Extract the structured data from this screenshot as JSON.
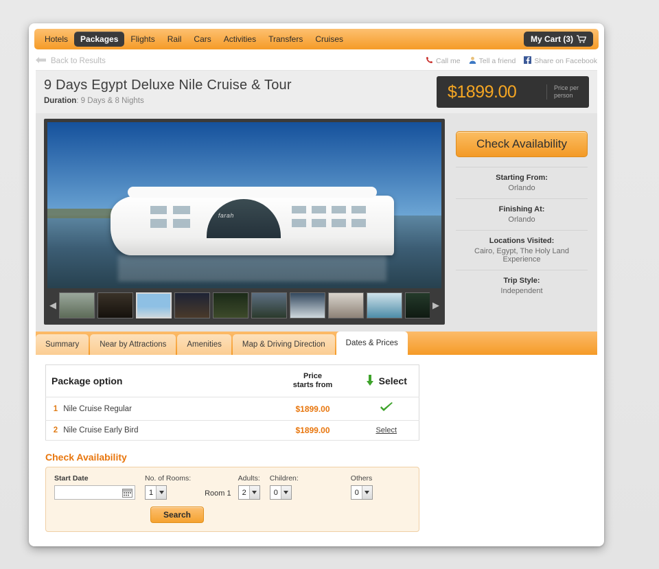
{
  "nav": {
    "items": [
      {
        "label": "Hotels",
        "active": false
      },
      {
        "label": "Packages",
        "active": true
      },
      {
        "label": "Flights",
        "active": false
      },
      {
        "label": "Rail",
        "active": false
      },
      {
        "label": "Cars",
        "active": false
      },
      {
        "label": "Activities",
        "active": false
      },
      {
        "label": "Transfers",
        "active": false
      },
      {
        "label": "Cruises",
        "active": false
      }
    ],
    "cart_label": "My Cart (3)",
    "cart_icon": "shopping-cart-icon"
  },
  "backbar": {
    "back_label": "Back to Results",
    "back_icon": "arrow-left-icon",
    "utils": [
      {
        "label": "Call me",
        "icon": "phone-icon"
      },
      {
        "label": "Tell a friend",
        "icon": "person-icon"
      },
      {
        "label": "Share on Facebook",
        "icon": "facebook-icon"
      }
    ]
  },
  "header": {
    "title": "9 Days Egypt Deluxe Nile Cruise & Tour",
    "duration_label": "Duration",
    "duration_value": "9 Days & 8 Nights",
    "price": "$1899.00",
    "price_note_line1": "Price per",
    "price_note_line2": "person",
    "price_color": "#f5a623"
  },
  "gallery": {
    "prev_icon": "chevron-left-icon",
    "next_icon": "chevron-right-icon",
    "main_image_alt": "Nile cruise ship farah on the river",
    "thumbnail_count": 10,
    "active_thumbnail_index": 2
  },
  "sidepanel": {
    "check_availability_label": "Check Availability",
    "facts": [
      {
        "key": "Starting From:",
        "value": "Orlando"
      },
      {
        "key": "Finishing At:",
        "value": "Orlando"
      },
      {
        "key": "Locations Visited:",
        "value": "Cairo, Egypt, The Holy Land Experience"
      },
      {
        "key": "Trip Style:",
        "value": "Independent"
      }
    ]
  },
  "tabs": [
    {
      "label": "Summary",
      "active": false
    },
    {
      "label": "Near by Attractions",
      "active": false
    },
    {
      "label": "Amenities",
      "active": false
    },
    {
      "label": "Map & Driving Direction",
      "active": false
    },
    {
      "label": "Dates & Prices",
      "active": true
    }
  ],
  "package_table": {
    "headers": {
      "option": "Package option",
      "price_line1": "Price",
      "price_line2": "starts from",
      "select": "Select",
      "select_icon": "arrow-down-icon"
    },
    "rows": [
      {
        "num": "1",
        "name": "Nile Cruise Regular",
        "price": "$1899.00",
        "selected": true,
        "select_label": ""
      },
      {
        "num": "2",
        "name": "Nile Cruise Early Bird",
        "price": "$1899.00",
        "selected": false,
        "select_label": "Select"
      }
    ]
  },
  "availability": {
    "title": "Check Availability",
    "start_date_label": "Start Date",
    "start_date_value": "",
    "start_date_placeholder": "",
    "calendar_icon": "calendar-icon",
    "rooms_label": "No. of Rooms:",
    "rooms_value": "1",
    "room_label": "Room 1",
    "adults_label": "Adults:",
    "adults_value": "2",
    "children_label": "Children:",
    "children_value": "0",
    "others_label": "Others",
    "others_value": "0",
    "search_label": "Search"
  }
}
